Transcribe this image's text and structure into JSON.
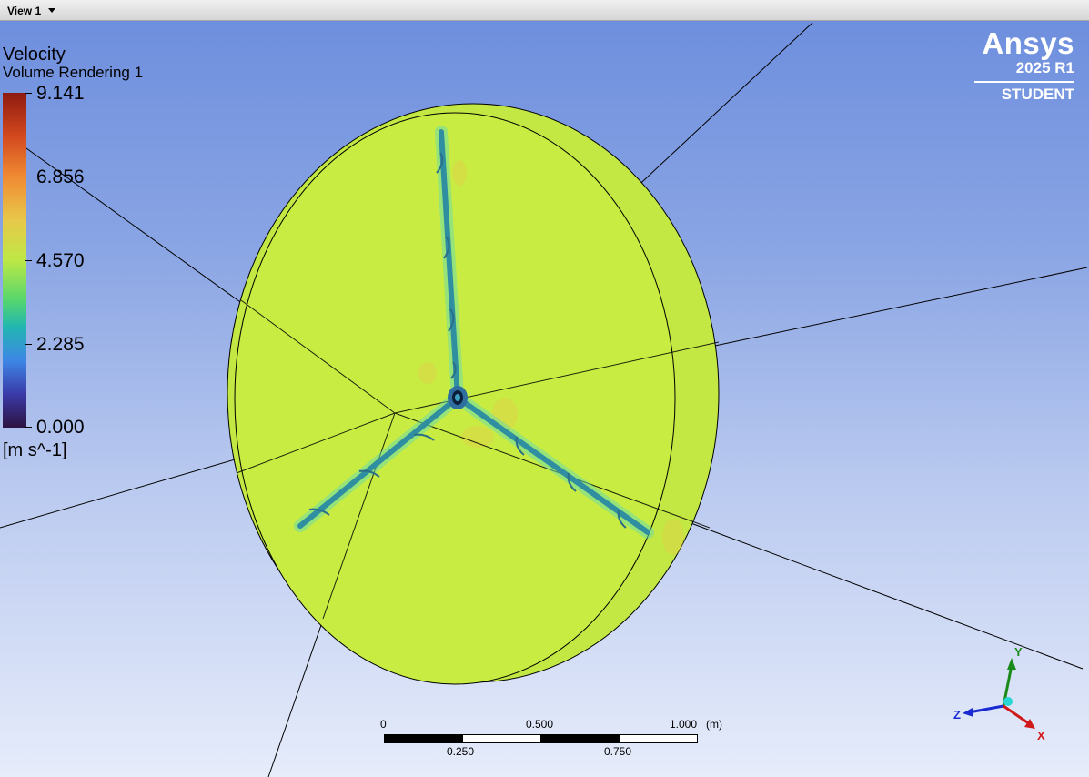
{
  "view_tab": {
    "label": "View 1"
  },
  "legend": {
    "title": "Velocity",
    "subtitle": "Volume Rendering 1",
    "labels": [
      "9.141",
      "6.856",
      "4.570",
      "2.285",
      "0.000"
    ],
    "unit": "[m s^-1]"
  },
  "logo": {
    "name": "Ansys",
    "version": "2025 R1",
    "edition": "STUDENT"
  },
  "scale": {
    "top_labels": [
      "0",
      "0.500",
      "1.000"
    ],
    "unit": "(m)",
    "bottom_labels": [
      "0.250",
      "0.750"
    ]
  },
  "triad": {
    "y": "Y",
    "z": "Z",
    "x": "X"
  },
  "colors": {
    "fluid": "#c9ec45",
    "blade": "#2f8fa0",
    "background_top": "#6e8fde",
    "background_bottom": "#e6ecfa"
  }
}
